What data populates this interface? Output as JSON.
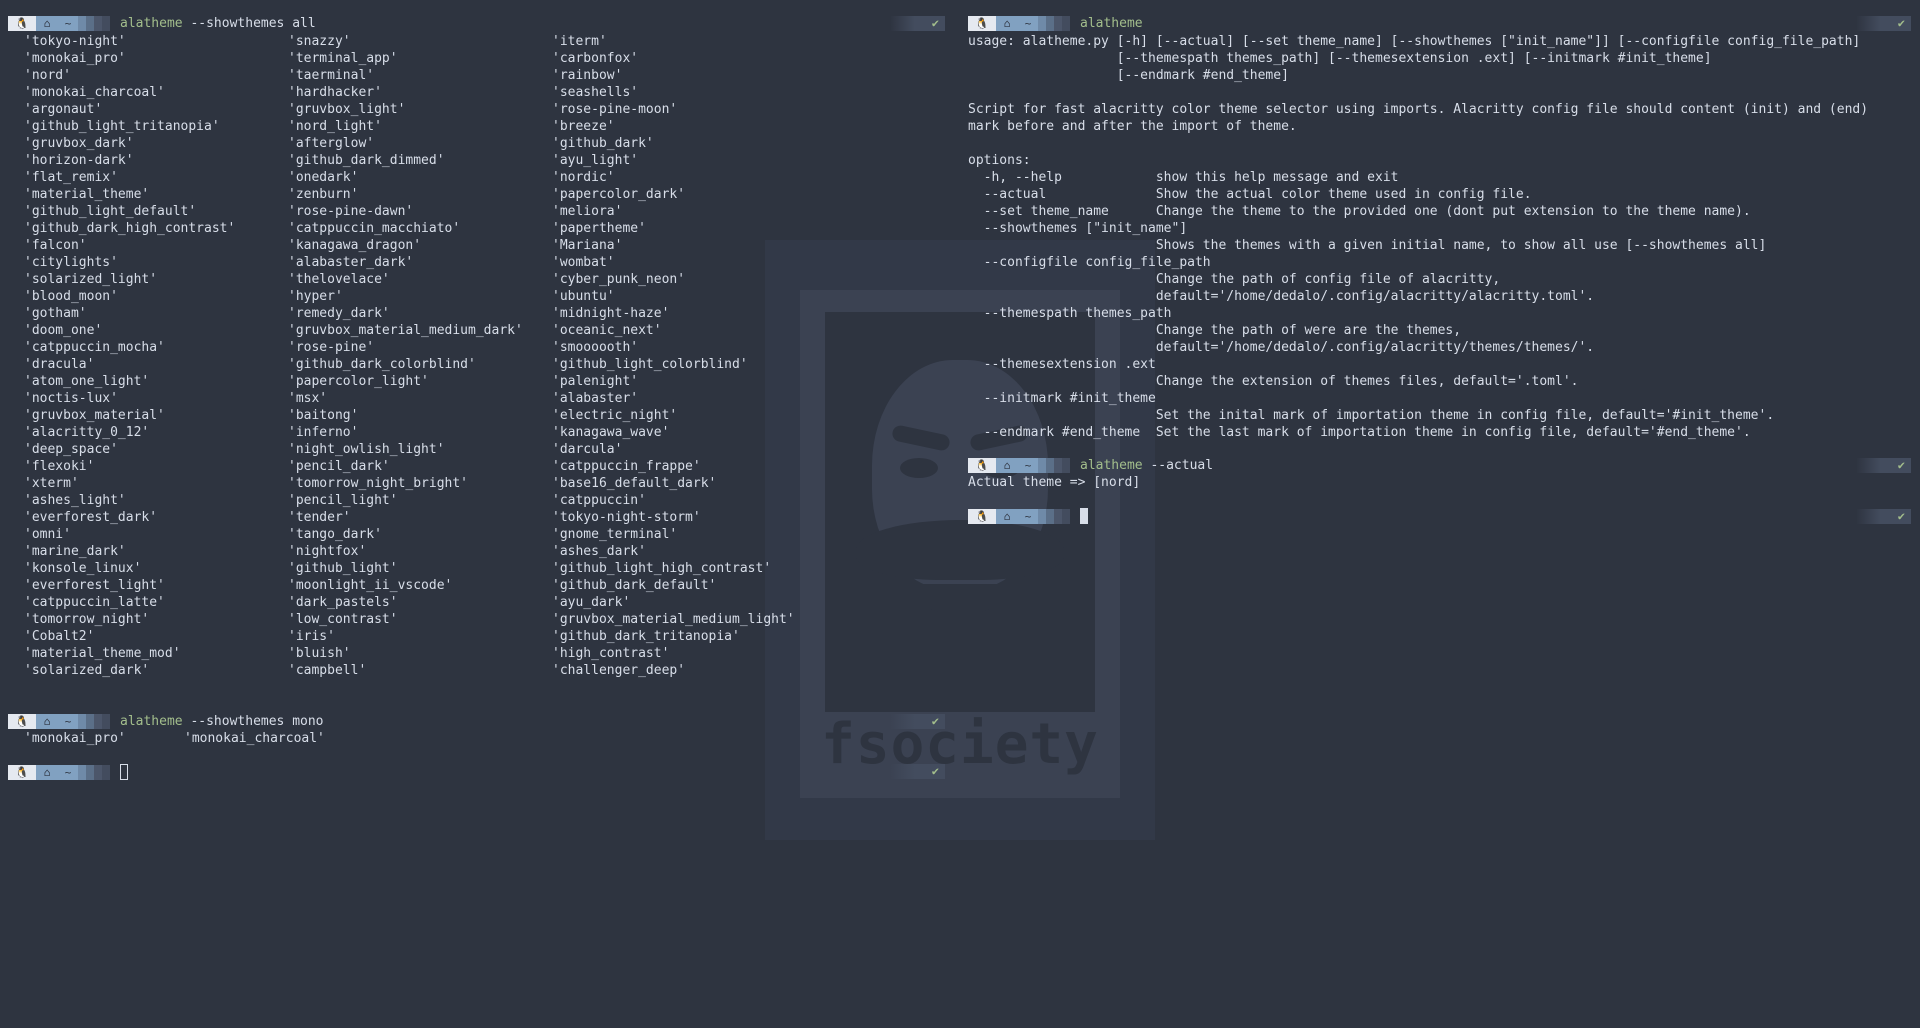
{
  "left": {
    "cmd1": {
      "name": "alatheme",
      "args": " --showthemes all",
      "status": "✔"
    },
    "col1": [
      "'tokyo-night'",
      "'monokai_pro'",
      "'nord'",
      "'monokai_charcoal'",
      "'argonaut'",
      "'github_light_tritanopia'",
      "'gruvbox_dark'",
      "'horizon-dark'",
      "'flat_remix'",
      "'material_theme'",
      "'github_light_default'",
      "'github_dark_high_contrast'",
      "'falcon'",
      "'citylights'",
      "'solarized_light'",
      "'blood_moon'",
      "'gotham'",
      "'doom_one'",
      "'catppuccin_mocha'",
      "'dracula'",
      "'atom_one_light'",
      "'noctis-lux'",
      "'gruvbox_material'",
      "'alacritty_0_12'",
      "'deep_space'",
      "'flexoki'",
      "'xterm'",
      "'ashes_light'",
      "'everforest_dark'",
      "'omni'",
      "'marine_dark'",
      "'konsole_linux'",
      "'everforest_light'",
      "'catppuccin_latte'",
      "'tomorrow_night'",
      "'Cobalt2'",
      "'material_theme_mod'",
      "'solarized_dark'"
    ],
    "col2": [
      "'snazzy'",
      "'terminal_app'",
      "'taerminal'",
      "'hardhacker'",
      "'gruvbox_light'",
      "'nord_light'",
      "'afterglow'",
      "'github_dark_dimmed'",
      "'onedark'",
      "'zenburn'",
      "'rose-pine-dawn'",
      "'catppuccin_macchiato'",
      "'kanagawa_dragon'",
      "'alabaster_dark'",
      "'thelovelace'",
      "'hyper'",
      "'remedy_dark'",
      "'gruvbox_material_medium_dark'",
      "'rose-pine'",
      "'github_dark_colorblind'",
      "'papercolor_light'",
      "'msx'",
      "'baitong'",
      "'inferno'",
      "'night_owlish_light'",
      "'pencil_dark'",
      "'tomorrow_night_bright'",
      "'pencil_light'",
      "'tender'",
      "'tango_dark'",
      "'nightfox'",
      "'github_light'",
      "'moonlight_ii_vscode'",
      "'dark_pastels'",
      "'low_contrast'",
      "'iris'",
      "'bluish'",
      "'campbell'"
    ],
    "col3": [
      "'iterm'",
      "'carbonfox'",
      "'rainbow'",
      "'seashells'",
      "'rose-pine-moon'",
      "'breeze'",
      "'github_dark'",
      "'ayu_light'",
      "'nordic'",
      "'papercolor_dark'",
      "'meliora'",
      "'papertheme'",
      "'Mariana'",
      "'wombat'",
      "'cyber_punk_neon'",
      "'ubuntu'",
      "'midnight-haze'",
      "'oceanic_next'",
      "'smoooooth'",
      "'github_light_colorblind'",
      "'palenight'",
      "'alabaster'",
      "'electric_night'",
      "'kanagawa_wave'",
      "'darcula'",
      "'catppuccin_frappe'",
      "'base16_default_dark'",
      "'catppuccin'",
      "'tokyo-night-storm'",
      "'gnome_terminal'",
      "'ashes_dark'",
      "'github_light_high_contrast'",
      "'github_dark_default'",
      "'ayu_dark'",
      "'gruvbox_material_medium_light'",
      "'github_dark_tritanopia'",
      "'high_contrast'",
      "'challenger_deep'"
    ],
    "cmd2": {
      "name": "alatheme",
      "args": " --showthemes mono",
      "status": "✔"
    },
    "mono_results": [
      "'monokai_pro'",
      "'monokai_charcoal'"
    ],
    "cmd3": {
      "status": "✔"
    }
  },
  "right": {
    "cmd1": {
      "name": "alatheme",
      "args": "",
      "status": "✔"
    },
    "help_lines": [
      "usage: alatheme.py [-h] [--actual] [--set theme_name] [--showthemes [\"init_name\"]] [--configfile config_file_path]",
      "                   [--themespath themes_path] [--themesextension .ext] [--initmark #init_theme]",
      "                   [--endmark #end_theme]",
      "",
      "Script for fast alacritty color theme selector using imports. Alacritty config file should content (init) and (end)",
      "mark before and after the import of theme.",
      "",
      "options:",
      "  -h, --help            show this help message and exit",
      "  --actual              Show the actual color theme used in config file.",
      "  --set theme_name      Change the theme to the provided one (dont put extension to the theme name).",
      "  --showthemes [\"init_name\"]",
      "                        Shows the themes with a given initial name, to show all use [--showthemes all]",
      "  --configfile config_file_path",
      "                        Change the path of config file of alacritty,",
      "                        default='/home/dedalo/.config/alacritty/alacritty.toml'.",
      "  --themespath themes_path",
      "                        Change the path of were are the themes,",
      "                        default='/home/dedalo/.config/alacritty/themes/themes/'.",
      "  --themesextension .ext",
      "                        Change the extension of themes files, default='.toml'.",
      "  --initmark #init_theme",
      "                        Set the inital mark of importation theme in config file, default='#init_theme'.",
      "  --endmark #end_theme  Set the last mark of importation theme in config file, default='#end_theme'."
    ],
    "cmd2": {
      "name": "alatheme",
      "args": " --actual",
      "status": "✔"
    },
    "actual_output": "Actual theme => [nord]",
    "cmd3": {
      "status": "✔"
    }
  },
  "prompt": {
    "os_icon": "🐧",
    "home_icon": "⌂",
    "dir": "~"
  },
  "wallpaper": {
    "logo_text": "fsociety"
  },
  "colors": {
    "background": "#2e3440",
    "command": "#a3be8c",
    "text": "#d8dee9"
  }
}
